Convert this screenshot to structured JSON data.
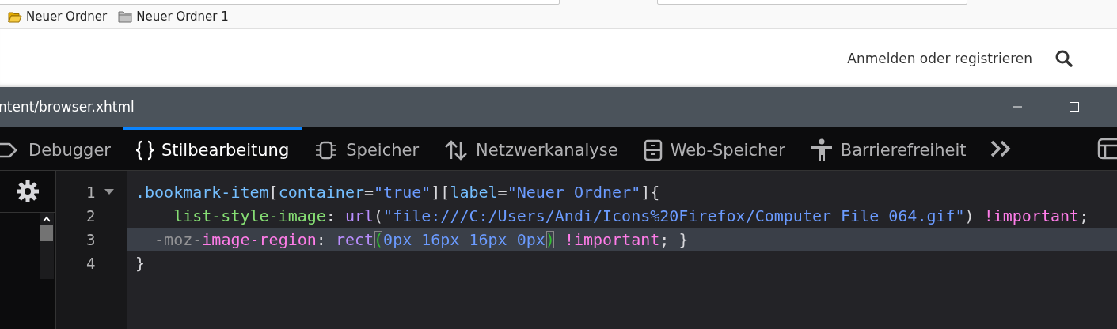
{
  "bookmarks": [
    {
      "label": "Neuer Ordner",
      "open": true
    },
    {
      "label": "Neuer Ordner 1",
      "open": false
    }
  ],
  "site_header": {
    "login_link": "Anmelden oder registrieren"
  },
  "devtools": {
    "title": "ntent/browser.xhtml",
    "tabs": [
      {
        "label": "Debugger",
        "kind": "debugger",
        "selected": false
      },
      {
        "label": "Stilbearbeitung",
        "kind": "style",
        "selected": true
      },
      {
        "label": "Speicher",
        "kind": "memory",
        "selected": false
      },
      {
        "label": "Netzwerkanalyse",
        "kind": "network",
        "selected": false
      },
      {
        "label": "Web-Speicher",
        "kind": "storage",
        "selected": false
      },
      {
        "label": "Barrierefreiheit",
        "kind": "accessibility",
        "selected": false
      }
    ],
    "editor": {
      "lines": [
        {
          "number": "1",
          "foldable": true,
          "highlighted": false,
          "tokens": [
            {
              "kind": "selector",
              "text": ".bookmark-item"
            },
            {
              "kind": "punct",
              "text": "["
            },
            {
              "kind": "selector",
              "text": "container"
            },
            {
              "kind": "punct",
              "text": "="
            },
            {
              "kind": "string",
              "text": "\"true\""
            },
            {
              "kind": "punct",
              "text": "]["
            },
            {
              "kind": "selector",
              "text": "label"
            },
            {
              "kind": "punct",
              "text": "="
            },
            {
              "kind": "string",
              "text": "\"Neuer Ordner\""
            },
            {
              "kind": "punct",
              "text": "]{"
            }
          ]
        },
        {
          "number": "2",
          "foldable": false,
          "highlighted": false,
          "tokens": [
            {
              "kind": "property",
              "text": "    list-style-image"
            },
            {
              "kind": "punct",
              "text": ": "
            },
            {
              "kind": "function",
              "text": "url"
            },
            {
              "kind": "punct",
              "text": "("
            },
            {
              "kind": "string",
              "text": "\"file:///C:/Users/Andi/Icons%20Firefox/Computer_File_064.gif\""
            },
            {
              "kind": "punct",
              "text": ") "
            },
            {
              "kind": "important",
              "text": "!important"
            },
            {
              "kind": "punct",
              "text": ";"
            }
          ]
        },
        {
          "number": "3",
          "foldable": false,
          "highlighted": true,
          "tokens": [
            {
              "kind": "vendor",
              "text": "  -moz-"
            },
            {
              "kind": "important",
              "text": "image-region"
            },
            {
              "kind": "punct",
              "text": ": "
            },
            {
              "kind": "function",
              "text": "rect"
            },
            {
              "kind": "match",
              "text": "("
            },
            {
              "kind": "string",
              "text": "0px 16px 16px 0px"
            },
            {
              "kind": "match",
              "text": ")"
            },
            {
              "kind": "important",
              "text": " !important"
            },
            {
              "kind": "punct",
              "text": "; }"
            }
          ]
        },
        {
          "number": "4",
          "foldable": false,
          "highlighted": false,
          "tokens": [
            {
              "kind": "punct",
              "text": "}"
            }
          ]
        }
      ]
    }
  }
}
